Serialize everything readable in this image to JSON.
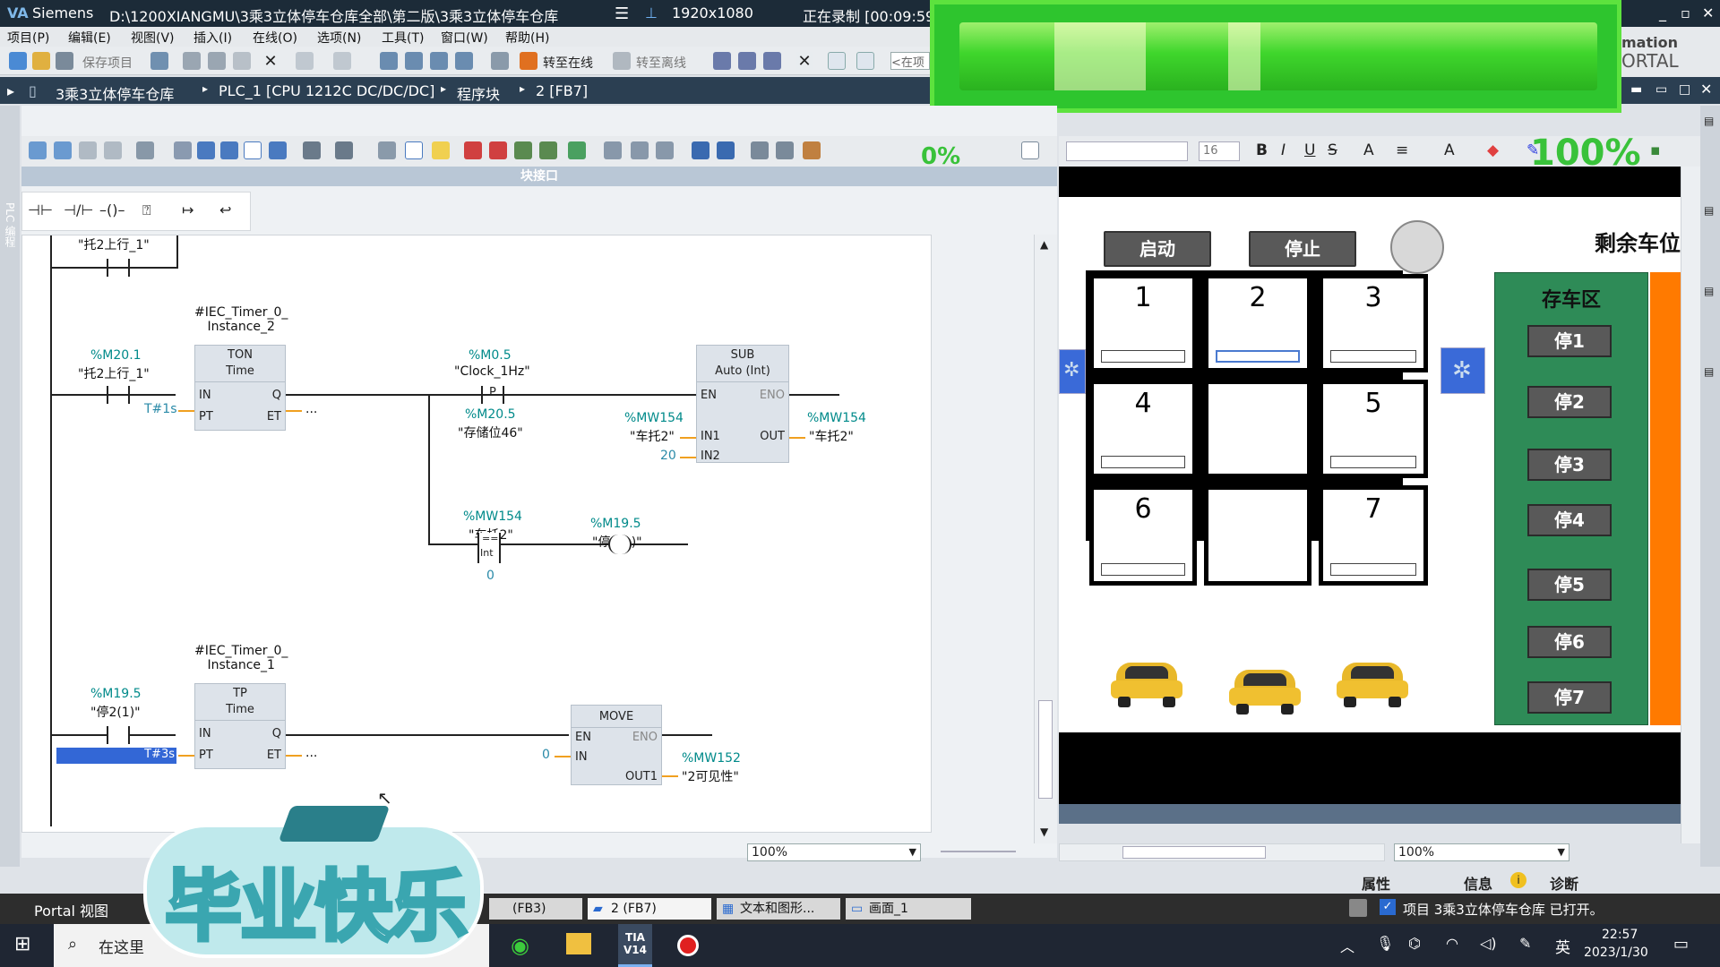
{
  "window": {
    "app_name": "Siemens",
    "path": "D:\\1200XIANGMU\\3乘3立体停车仓库全部\\第二版\\3乘3立体停车仓库",
    "resolution": "1920x1080",
    "recording": "正在录制 [00:09:59]"
  },
  "brand": {
    "line1": "mation",
    "line2": "ORTAL"
  },
  "menu": [
    "项目(P)",
    "编辑(E)",
    "视图(V)",
    "插入(I)",
    "在线(O)",
    "选项(N)",
    "工具(T)",
    "窗口(W)",
    "帮助(H)"
  ],
  "toolbar": {
    "save_project": "保存项目",
    "go_online": "转至在线",
    "go_offline": "转至离线",
    "search": "<在项"
  },
  "breadcrumb": [
    "3乘3立体停车仓库",
    "PLC_1 [CPU 1212C DC/DC/DC]",
    "程序块",
    "2 [FB7]"
  ],
  "progress": {
    "left_label": "0%",
    "right_label": "100%"
  },
  "editor": {
    "block_interface": "块接口",
    "side_label": "PLC 编程",
    "zoom": "100%",
    "network0": {
      "contact_label": "\"托2上行_1\""
    },
    "network1": {
      "timer_instance": "#IEC_Timer_0_\nInstance_2",
      "contact_addr": "%M20.1",
      "contact_label": "\"托2上行_1\"",
      "ton_type": "TON",
      "ton_sub": "Time",
      "pin_in": "IN",
      "pin_q": "Q",
      "pin_pt": "PT",
      "pin_et": "ET",
      "pt_value": "T#1s",
      "et_value": "...",
      "clock_addr": "%M0.5",
      "clock_label": "\"Clock_1Hz\"",
      "edge_addr": "%M20.5",
      "edge_label": "\"存储位46\"",
      "sub_type": "SUB",
      "sub_sub": "Auto (Int)",
      "pin_en": "EN",
      "pin_eno": "ENO",
      "pin_in1": "IN1",
      "pin_in2": "IN2",
      "pin_out": "OUT",
      "in1_addr": "%MW154",
      "in1_label": "\"车托2\"",
      "in2_value": "20",
      "out_addr": "%MW154",
      "out_label": "\"车托2\"",
      "cmp_addr": "%MW154",
      "cmp_label": "\"车托2\"",
      "cmp_op": "==",
      "cmp_type": "Int",
      "cmp_value": "0",
      "coil_addr": "%M19.5",
      "coil_label": "\"停2(1)\""
    },
    "network2": {
      "timer_instance": "#IEC_Timer_0_\nInstance_1",
      "contact_addr": "%M19.5",
      "contact_label": "\"停2(1)\"",
      "tp_type": "TP",
      "tp_sub": "Time",
      "pin_in": "IN",
      "pin_q": "Q",
      "pin_pt": "PT",
      "pin_et": "ET",
      "pt_value": "T#3s",
      "et_value": "...",
      "move_type": "MOVE",
      "pin_en": "EN",
      "pin_eno": "ENO",
      "pin_out1": "OUT1",
      "move_in": "0",
      "out_addr": "%MW152",
      "out_label": "\"2可见性\""
    }
  },
  "hmi": {
    "start_label": "启动",
    "stop_label": "停止",
    "remaining_label": "剩余车位",
    "area_title": "存车区",
    "cells": [
      "1",
      "2",
      "3",
      "4",
      "",
      "5",
      "6",
      "",
      "7"
    ],
    "park_buttons": [
      "停1",
      "停2",
      "停3",
      "停4",
      "停5",
      "停6",
      "停7"
    ],
    "zoom": "100%",
    "font_size": "16"
  },
  "statusbar": {
    "properties": "属性",
    "info": "信息",
    "diagnostics": "诊断"
  },
  "tabs": [
    {
      "label": "Portal 视图"
    },
    {
      "label": "(FB3)"
    },
    {
      "label": "2 (FB7)"
    },
    {
      "label": "文本和图形..."
    },
    {
      "label": "画面_1"
    }
  ],
  "status_message": "项目 3乘3立体停车仓库 已打开。",
  "taskbar": {
    "search_placeholder": "在这里",
    "tia_label": "TIA V14",
    "ime": "英",
    "time": "22:57",
    "date": "2023/1/30"
  },
  "sticker": {
    "text": "毕业快乐"
  },
  "colors": {
    "accent_green": "#2ec52e",
    "hmi_park_area": "#2e8b57",
    "hmi_orange": "#ff7a00",
    "ladder_tag": "#008a8a"
  }
}
